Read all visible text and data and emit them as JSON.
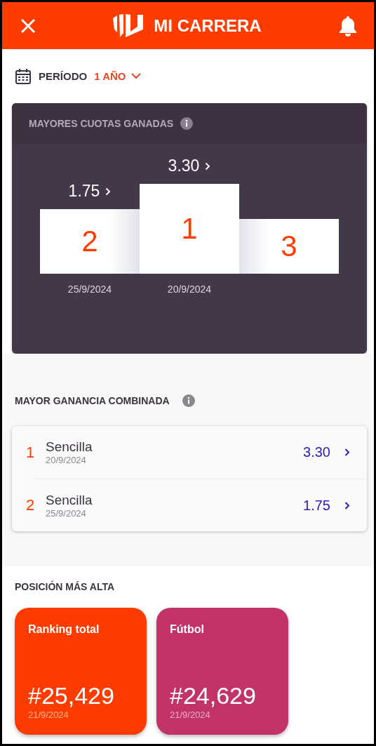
{
  "header": {
    "title": "MI CARRERA"
  },
  "period": {
    "label": "PERÍODO",
    "value": "1 AÑO"
  },
  "top_odds": {
    "title": "MAYORES CUOTAS GANADAS",
    "podium": [
      {
        "rank": "2",
        "odds": "1.75",
        "date": "25/9/2024"
      },
      {
        "rank": "1",
        "odds": "3.30",
        "date": "20/9/2024"
      },
      {
        "rank": "3"
      }
    ]
  },
  "combined": {
    "title": "MAYOR GANANCIA COMBINADA",
    "rows": [
      {
        "rank": "1",
        "name": "Sencilla",
        "date": "20/9/2024",
        "odds": "3.30"
      },
      {
        "rank": "2",
        "name": "Sencilla",
        "date": "25/9/2024",
        "odds": "1.75"
      }
    ]
  },
  "highest_position": {
    "title": "POSICIÓN MÁS ALTA",
    "cards": [
      {
        "label": "Ranking total",
        "position": "#25,429",
        "date": "21/9/2024",
        "color": "#ff3c00"
      },
      {
        "label": "Fútbol",
        "position": "#24,629",
        "date": "21/9/2024",
        "color": "#c23467"
      }
    ]
  }
}
